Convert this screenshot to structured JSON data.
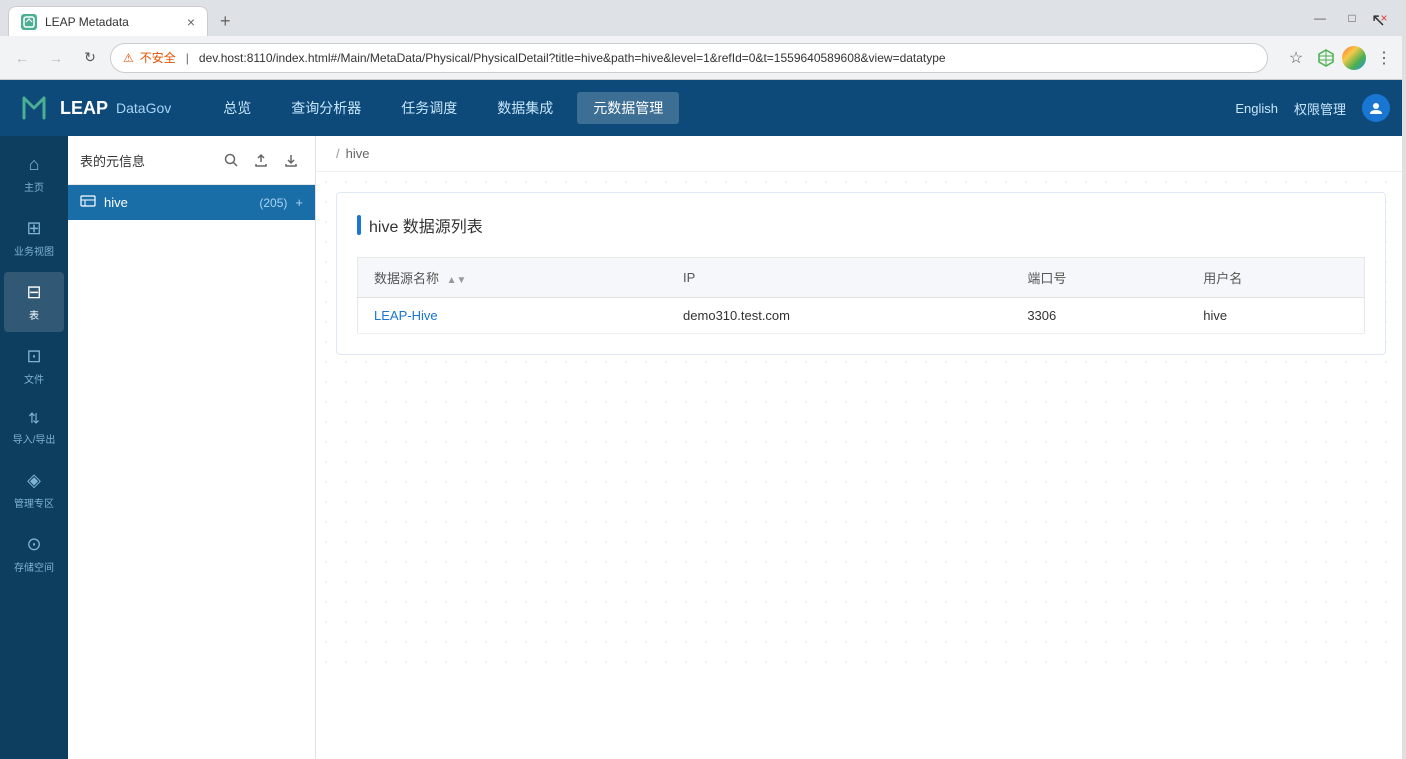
{
  "browser": {
    "tab_title": "LEAP Metadata",
    "tab_close": "×",
    "new_tab": "+",
    "back_disabled": true,
    "forward_disabled": true,
    "security_label": "不安全",
    "url": "dev.host:8110/index.html#/Main/MetaData/Physical/PhysicalDetail?title=hive&path=hive&level=1&refId=0&t=1559640589608&view=datatype",
    "window_controls": {
      "minimize": "—",
      "maximize": "□",
      "close": "×"
    }
  },
  "app": {
    "logo_text": "LEAP",
    "subtitle": "DataGov",
    "nav": [
      {
        "label": "总览",
        "active": false
      },
      {
        "label": "查询分析器",
        "active": false
      },
      {
        "label": "任务调度",
        "active": false
      },
      {
        "label": "数据集成",
        "active": false
      },
      {
        "label": "元数据管理",
        "active": true
      }
    ],
    "lang": "English",
    "admin": "权限管理"
  },
  "sidebar": {
    "items": [
      {
        "icon": "⌂",
        "label": "主页"
      },
      {
        "icon": "⊞",
        "label": "业务视图"
      },
      {
        "icon": "⊟",
        "label": "表",
        "active": true
      },
      {
        "icon": "⊡",
        "label": "文件"
      },
      {
        "icon": "↑↓",
        "label": "导入/导出"
      },
      {
        "icon": "◈",
        "label": "管理专区"
      },
      {
        "icon": "⊙",
        "label": "存储空间"
      }
    ]
  },
  "tree_panel": {
    "title": "表的元信息",
    "hive_item": {
      "label": "hive",
      "count": "(205)",
      "add": "+"
    }
  },
  "breadcrumb": {
    "separator": "/",
    "current": "hive"
  },
  "content": {
    "section_title": "hive 数据源列表",
    "table": {
      "columns": [
        {
          "label": "数据源名称",
          "sortable": true
        },
        {
          "label": "IP"
        },
        {
          "label": "端口号"
        },
        {
          "label": "用户名"
        }
      ],
      "rows": [
        {
          "name": "LEAP-Hive",
          "ip": "demo310.test.com",
          "port": "3306",
          "username": "hive"
        }
      ]
    }
  }
}
